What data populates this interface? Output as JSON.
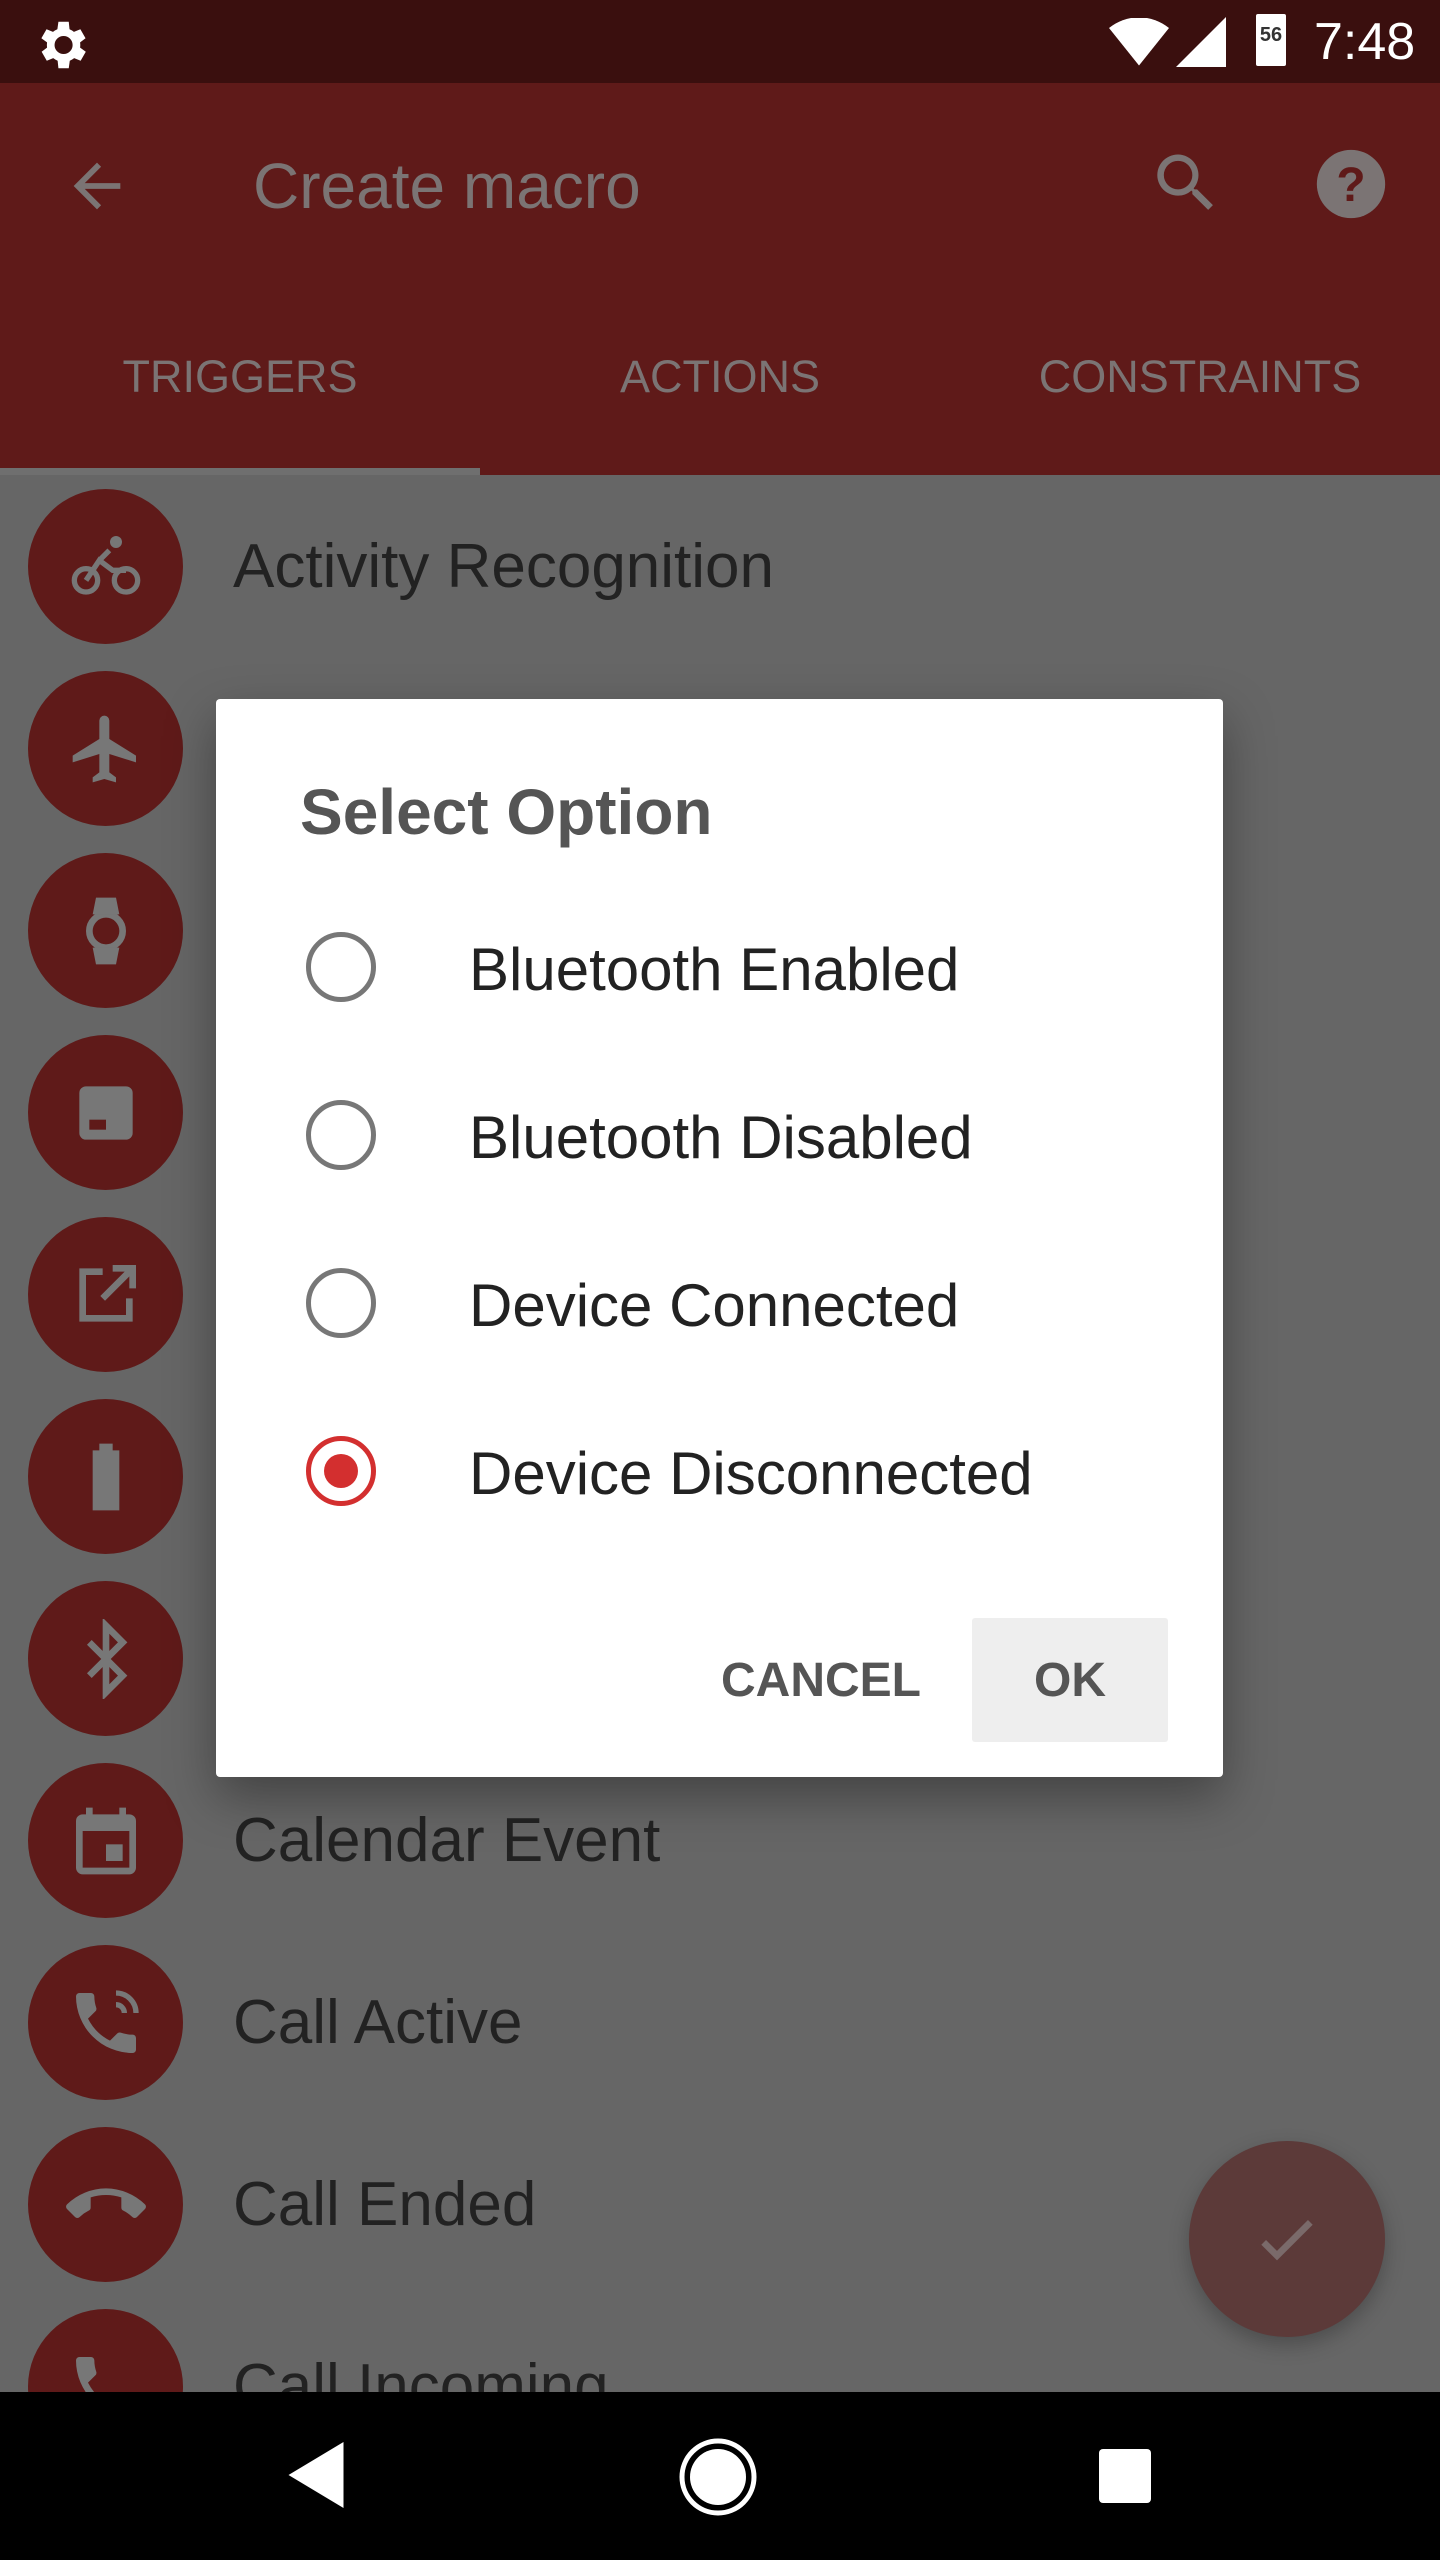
{
  "status_bar": {
    "time": "7:48",
    "battery": "56",
    "icons": [
      "settings-icon",
      "wifi-icon",
      "signal-icon",
      "battery-icon"
    ]
  },
  "app_bar": {
    "title": "Create macro",
    "icons": [
      "back-arrow-icon",
      "search-icon",
      "help-icon"
    ]
  },
  "tabs": [
    {
      "label": "TRIGGERS",
      "selected": true
    },
    {
      "label": "ACTIONS",
      "selected": false
    },
    {
      "label": "CONSTRAINTS",
      "selected": false
    }
  ],
  "triggers": [
    {
      "label": "Activity Recognition",
      "icon": "bicycle-icon"
    },
    {
      "label": "",
      "icon": "airplane-icon"
    },
    {
      "label": "",
      "icon": "watch-icon"
    },
    {
      "label": "",
      "icon": "card-icon"
    },
    {
      "label": "",
      "icon": "open-external-icon"
    },
    {
      "label": "",
      "icon": "battery-icon"
    },
    {
      "label": "",
      "icon": "bluetooth-icon"
    },
    {
      "label": "Calendar Event",
      "icon": "calendar-icon"
    },
    {
      "label": "Call Active",
      "icon": "phone-in-talk-icon"
    },
    {
      "label": "Call Ended",
      "icon": "call-end-icon"
    },
    {
      "label": "Call Incoming",
      "icon": "phone-icon"
    }
  ],
  "dialog": {
    "title": "Select Option",
    "options": [
      {
        "label": "Bluetooth Enabled",
        "selected": false
      },
      {
        "label": "Bluetooth Disabled",
        "selected": false
      },
      {
        "label": "Device Connected",
        "selected": false
      },
      {
        "label": "Device Disconnected",
        "selected": true
      }
    ],
    "cancel": "CANCEL",
    "ok": "OK"
  },
  "fab": {
    "icon": "check-icon"
  },
  "colors": {
    "accent": "#d32f2f",
    "app_bar_dimmed": "#5f1a19"
  }
}
